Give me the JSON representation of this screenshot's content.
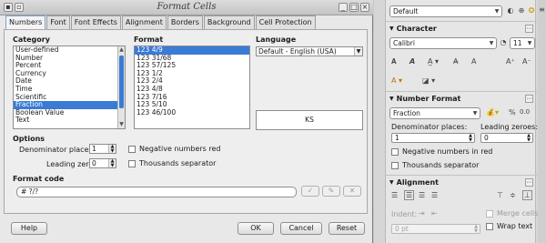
{
  "dialog": {
    "title": "Format Cells",
    "tabs": [
      "Numbers",
      "Font",
      "Font Effects",
      "Alignment",
      "Borders",
      "Background",
      "Cell Protection"
    ],
    "category": {
      "label": "Category",
      "items": [
        "User-defined",
        "Number",
        "Percent",
        "Currency",
        "Date",
        "Time",
        "Scientific",
        "Fraction",
        "Boolean Value",
        "Text"
      ],
      "selected": "Fraction"
    },
    "format": {
      "label": "Format",
      "items": [
        "123 4/9",
        "123 31/68",
        "123  57/125",
        "123 1/2",
        "123 2/4",
        "123 4/8",
        "123  7/16",
        "123  5/10",
        "123 46/100"
      ],
      "selected": "123 4/9"
    },
    "language": {
      "label": "Language",
      "value": "Default - English (USA)"
    },
    "preview_text": "KS",
    "options": {
      "label": "Options",
      "denominator_label": "Denominator places:",
      "denominator_value": "1",
      "leading_zeroes_label": "Leading zeroes:",
      "leading_zeroes_value": "0",
      "negative_red": "Negative numbers red",
      "thousands_separator": "Thousands separator"
    },
    "format_code": {
      "label": "Format code",
      "value": "# ?/?"
    },
    "buttons": {
      "help": "Help",
      "ok": "OK",
      "cancel": "Cancel",
      "reset": "Reset"
    }
  },
  "sidebar": {
    "style_value": "Default",
    "character": {
      "heading": "Character",
      "font_name": "Calibri",
      "font_size": "11"
    },
    "number_format": {
      "heading": "Number Format",
      "category_value": "Fraction",
      "percent_symbol": "%",
      "decimal_value": "0.0",
      "denominator_label": "Denominator places:",
      "denominator_value": "1",
      "leading_zeroes_label": "Leading zeroes:",
      "leading_zeroes_value": "0",
      "negative_red": "Negative numbers in red",
      "thousands_separator": "Thousands separator"
    },
    "alignment": {
      "heading": "Alignment",
      "indent_label": "Indent:",
      "indent_value": "0 pt",
      "merge_cells": "Merge cells",
      "wrap_text": "Wrap text"
    }
  },
  "colors": {
    "selection": "#3a7bd5",
    "dialog_bg": "#e8e8e8",
    "sidebar_bg": "#e6e6e6"
  }
}
